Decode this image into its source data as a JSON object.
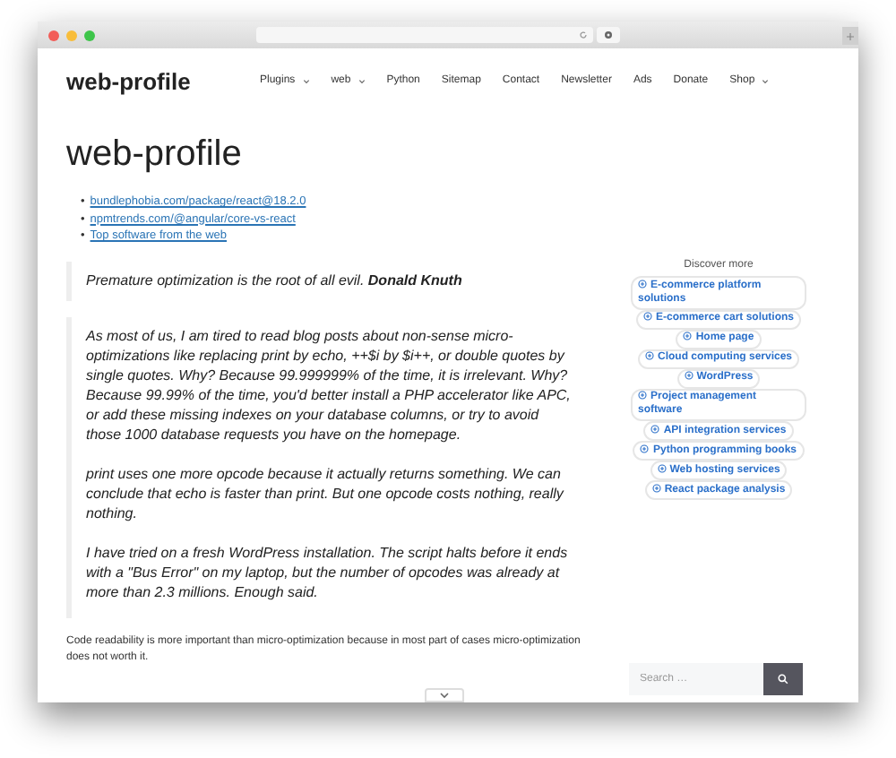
{
  "site": {
    "logo": "web-profile"
  },
  "nav": [
    {
      "label": "Plugins",
      "dropdown": true
    },
    {
      "label": "web",
      "dropdown": true
    },
    {
      "label": "Python",
      "dropdown": false
    },
    {
      "label": "Sitemap",
      "dropdown": false
    },
    {
      "label": "Contact",
      "dropdown": false
    },
    {
      "label": "Newsletter",
      "dropdown": false
    },
    {
      "label": "Ads",
      "dropdown": false
    },
    {
      "label": "Donate",
      "dropdown": false
    },
    {
      "label": "Shop",
      "dropdown": true
    }
  ],
  "page_title": "web-profile",
  "links": [
    {
      "bullet": "•",
      "text": "bundlephobia.com/package/react@18.2.0"
    },
    {
      "bullet": "•",
      "text": "npmtrends.com/@angular/core-vs-react"
    },
    {
      "bullet": "•",
      "text": "Top software from the web"
    }
  ],
  "quote": "Premature optimization is the root of all evil. **Donald Knuth**",
  "blockquote": [
    "As most of us, I am tired to read blog posts about non-sense micro-optimizations like replacing print by echo, ++$i by $i++, or double quotes by single quotes. Why? Because 99.999999% of the time, it is irrelevant. Why? Because 99.99% of the time, you'd better install a PHP accelerator like APC, or add these missing indexes on your database columns, or try to avoid those 1000 database requests you have on the homepage.",
    "print uses one more opcode because it actually returns something. We can conclude that echo is faster than print. But one opcode costs nothing, really nothing.",
    "I have tried on a fresh WordPress installation. The script halts before it ends with a \"Bus Error\" on my laptop, but the number of opcodes was already at more than 2.3 millions. Enough said."
  ],
  "paragraph": "Code readability is more important than micro-optimization because in most part of cases micro-optimization does not worth it.",
  "sidebar": {
    "title": "Discover more",
    "chips": [
      "E-commerce platform solutions",
      "E-commerce cart solutions",
      "Home page",
      "Cloud computing services",
      "WordPress",
      "Project management software",
      "API integration services",
      "Python programming books",
      "Web hosting services",
      "React package analysis"
    ]
  },
  "search": {
    "placeholder": "Search …"
  }
}
